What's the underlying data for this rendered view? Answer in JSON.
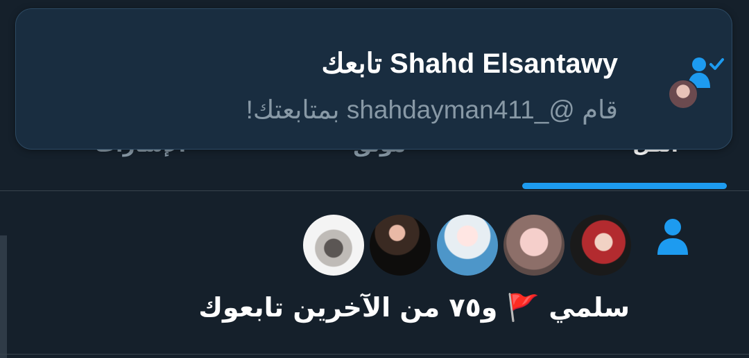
{
  "tabs": [
    {
      "label": "الكل",
      "active": true
    },
    {
      "label": "موثق",
      "active": false
    },
    {
      "label": "الإشارات",
      "active": false
    }
  ],
  "toast": {
    "title": "Shahd Elsantawy تابعك",
    "subtitle": "قام @_shahdayman411 بمتابعتك!",
    "icon": "person-check-icon"
  },
  "notification": {
    "icon": "person-icon",
    "avatars": [
      "avatar-1",
      "avatar-2",
      "avatar-3",
      "avatar-4",
      "avatar-5"
    ],
    "text_name": "سلمي",
    "flag": "🚩",
    "text_rest": "و٧٥ من الآخرين تابعوك"
  },
  "colors": {
    "accent": "#1d9bf0",
    "background": "#15202b",
    "toast_background": "#192d40",
    "muted_text": "#8899a6"
  }
}
